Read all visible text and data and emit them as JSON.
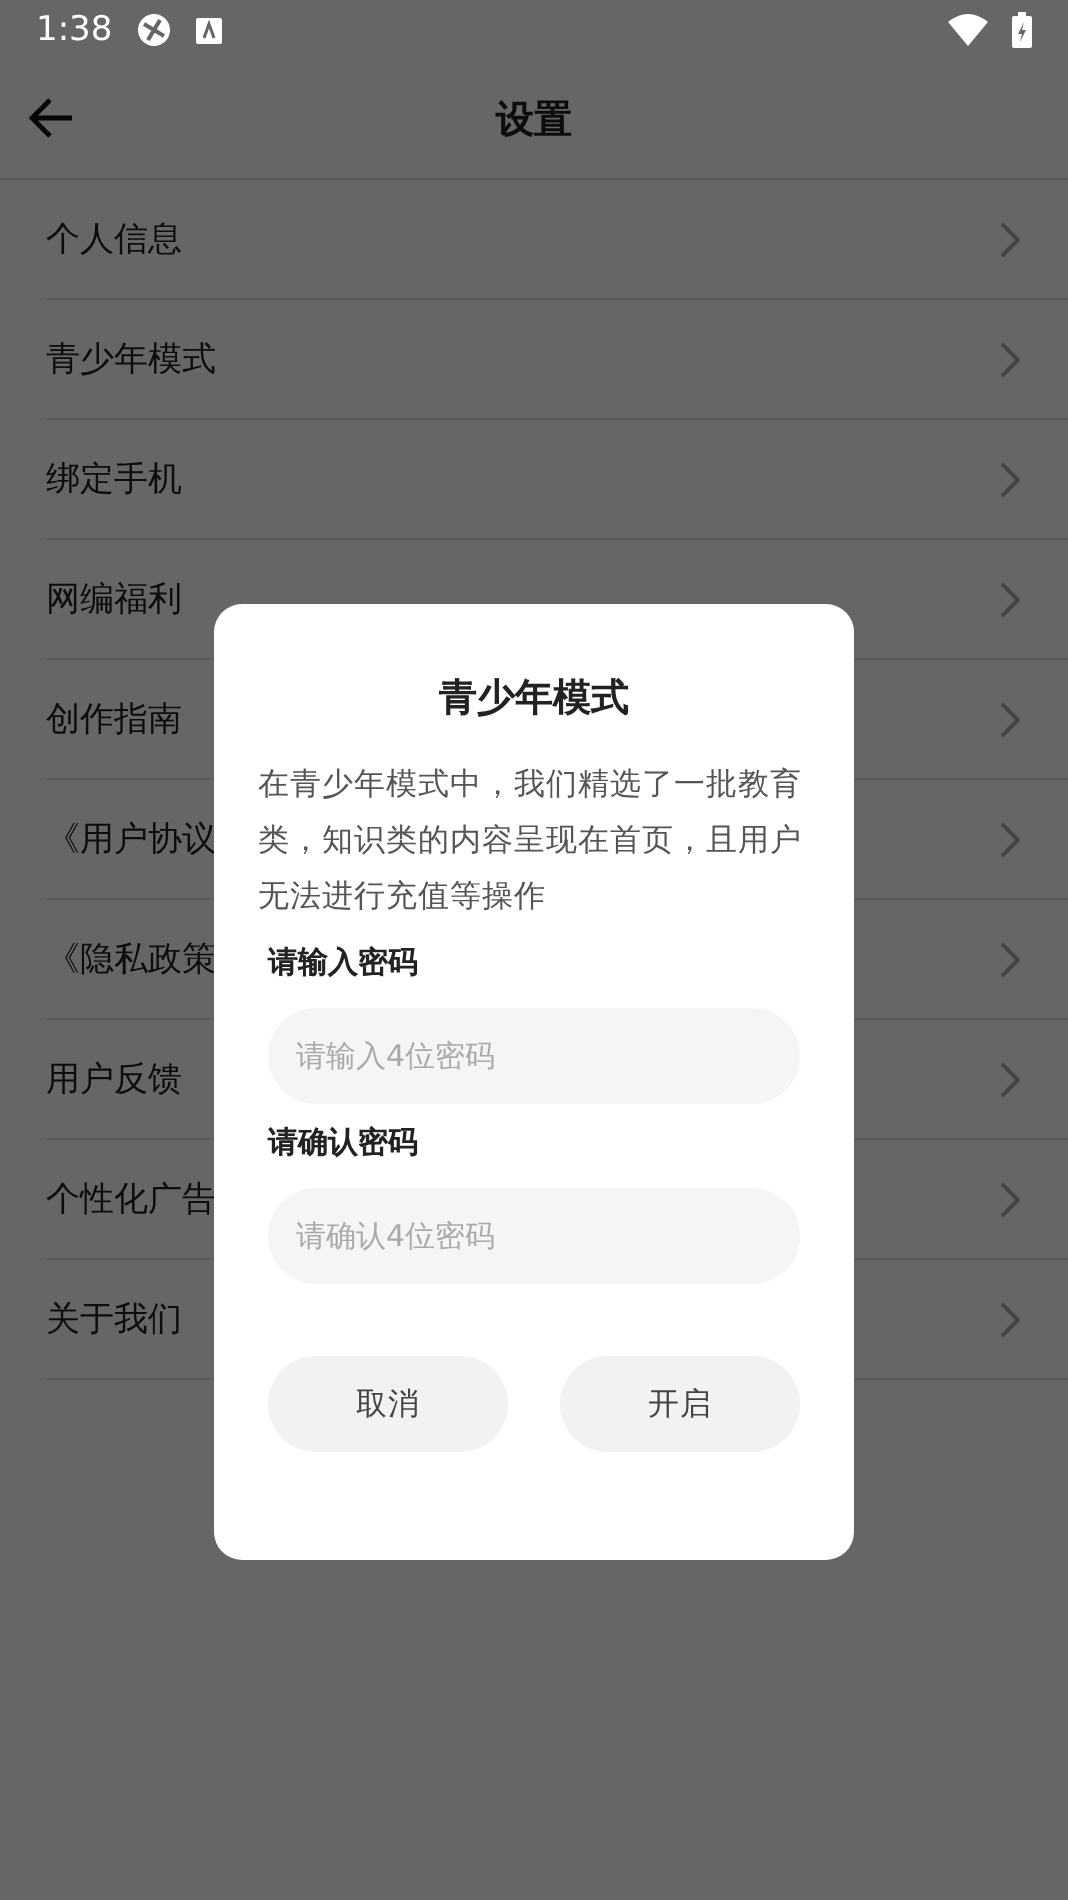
{
  "status_bar": {
    "time": "1:38"
  },
  "header": {
    "title": "设置"
  },
  "settings_items": [
    {
      "label": "个人信息"
    },
    {
      "label": "青少年模式"
    },
    {
      "label": "绑定手机"
    },
    {
      "label": "网编福利"
    },
    {
      "label": "创作指南"
    },
    {
      "label": "《用户协议"
    },
    {
      "label": "《隐私政策"
    },
    {
      "label": "用户反馈"
    },
    {
      "label": "个性化广告"
    },
    {
      "label": "关于我们"
    }
  ],
  "dialog": {
    "title": "青少年模式",
    "description": "在青少年模式中，我们精选了一批教育类，知识类的内容呈现在首页，且用户无法进行充值等操作",
    "fields": [
      {
        "label": "请输入密码",
        "placeholder": "请输入4位密码"
      },
      {
        "label": "请确认密码",
        "placeholder": "请确认4位密码"
      }
    ],
    "buttons": [
      "取消",
      "开启"
    ]
  }
}
